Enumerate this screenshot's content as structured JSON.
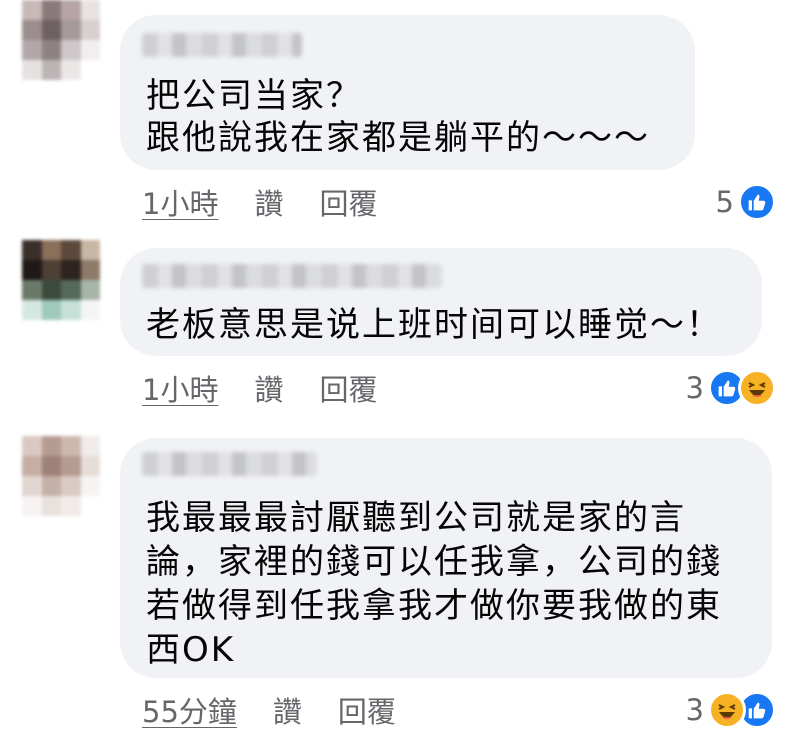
{
  "comments": [
    {
      "text": "把公司当家？\n跟他說我在家都是躺平的～～～",
      "time": "1小時",
      "like_label": "讚",
      "reply_label": "回覆",
      "reaction_count": "5",
      "reactions": [
        "like-icon"
      ]
    },
    {
      "text": "老板意思是说上班时间可以睡觉～！",
      "time": "1小時",
      "like_label": "讚",
      "reply_label": "回覆",
      "reaction_count": "3",
      "reactions": [
        "like-icon",
        "haha-icon"
      ]
    },
    {
      "text": "我最最最討厭聽到公司就是家的言\n論，家裡的錢可以任我拿，公司的錢\n若做得到任我拿我才做你要我做的東\n西OK",
      "time": "55分鐘",
      "like_label": "讚",
      "reply_label": "回覆",
      "reaction_count": "3",
      "reactions": [
        "haha-icon",
        "like-icon"
      ]
    }
  ],
  "colors": {
    "bubble": "#f0f2f5",
    "meta_text": "#65676b",
    "like_blue": "#1877f2",
    "haha_yellow": "#f7b125"
  }
}
